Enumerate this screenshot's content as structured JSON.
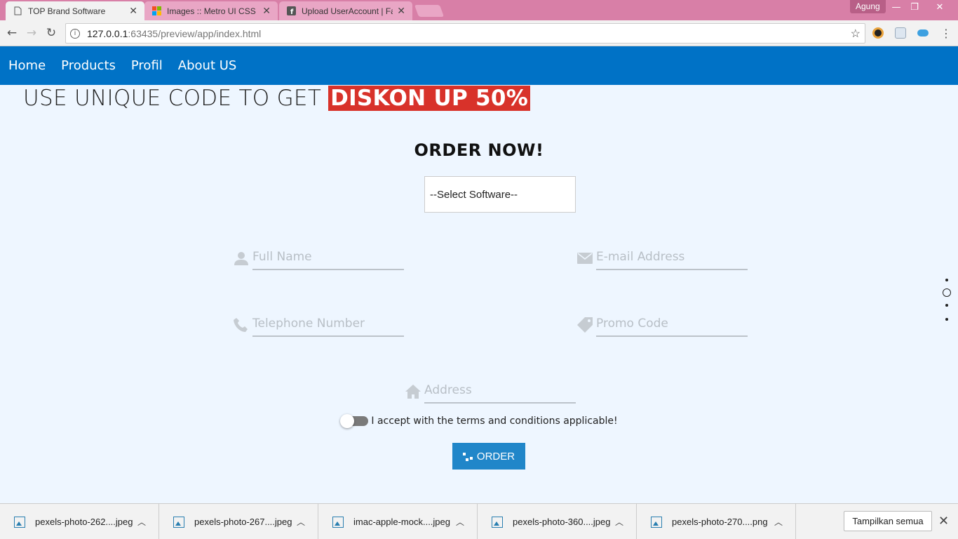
{
  "browser": {
    "tabs": [
      {
        "title": "TOP Brand Software",
        "icon": "document-icon",
        "active": true
      },
      {
        "title": "Images :: Metro UI CSS -",
        "icon": "windows-logo-icon",
        "active": false
      },
      {
        "title": "Upload UserAccount | Fa",
        "icon": "facebook-icon",
        "active": false
      }
    ],
    "profile": "Agung",
    "url_host": "127.0.0.1",
    "url_path": ":63435/preview/app/index.html"
  },
  "nav": {
    "items": [
      "Home",
      "Products",
      "Profil",
      "About US"
    ]
  },
  "promo": {
    "text": "USE UNIQUE CODE TO GET",
    "highlight": "DISKON UP 50%"
  },
  "order": {
    "title": "ORDER NOW!",
    "select_value": "--Select Software--",
    "fields": {
      "full_name": "Full Name",
      "email": "E-mail Address",
      "telephone": "Telephone Number",
      "promo_code": "Promo Code",
      "address": "Address"
    },
    "terms": "I accept with the terms and conditions applicable!",
    "button": "ORDER"
  },
  "downloads": {
    "items": [
      "pexels-photo-262....jpeg",
      "pexels-photo-267....jpeg",
      "imac-apple-mock....jpeg",
      "pexels-photo-360....jpeg",
      "pexels-photo-270....png"
    ],
    "show_all": "Tampilkan semua"
  },
  "colors": {
    "nav": "#0072c6",
    "highlight": "#d8322a",
    "button": "#2086c9",
    "page_bg": "#eef6ff"
  }
}
